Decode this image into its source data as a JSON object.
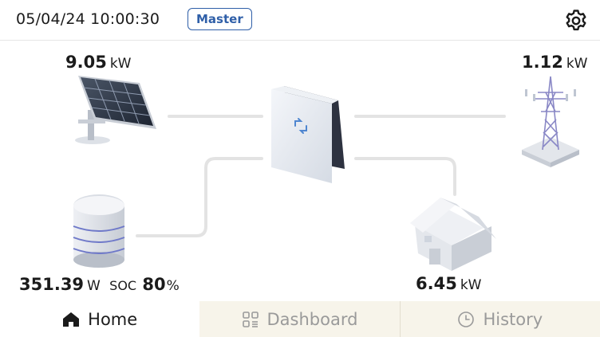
{
  "header": {
    "datetime": "05/04/24 10:00:30",
    "role_badge": "Master",
    "settings_icon": "gear-icon"
  },
  "flow": {
    "solar": {
      "value": "9.05",
      "unit": "kW",
      "icon": "solar-panel-icon"
    },
    "grid": {
      "value": "1.12",
      "unit": "kW",
      "icon": "transmission-tower-icon"
    },
    "battery": {
      "value": "351.39",
      "unit": "W",
      "soc_label": "SOC",
      "soc_value": "80",
      "soc_unit": "%",
      "icon": "battery-icon"
    },
    "home": {
      "value": "6.45",
      "unit": "kW",
      "icon": "house-icon"
    },
    "inverter": {
      "icon": "inverter-icon"
    }
  },
  "tabs": [
    {
      "label": "Home",
      "icon": "home-icon",
      "active": true
    },
    {
      "label": "Dashboard",
      "icon": "dashboard-icon",
      "active": false
    },
    {
      "label": "History",
      "icon": "clock-icon",
      "active": false
    }
  ],
  "colors": {
    "accent": "#2f5fa8",
    "flow_line": "#e3e3e3",
    "flow_active": "#4f86d0",
    "tab_inactive_bg": "#f7f4ea"
  }
}
